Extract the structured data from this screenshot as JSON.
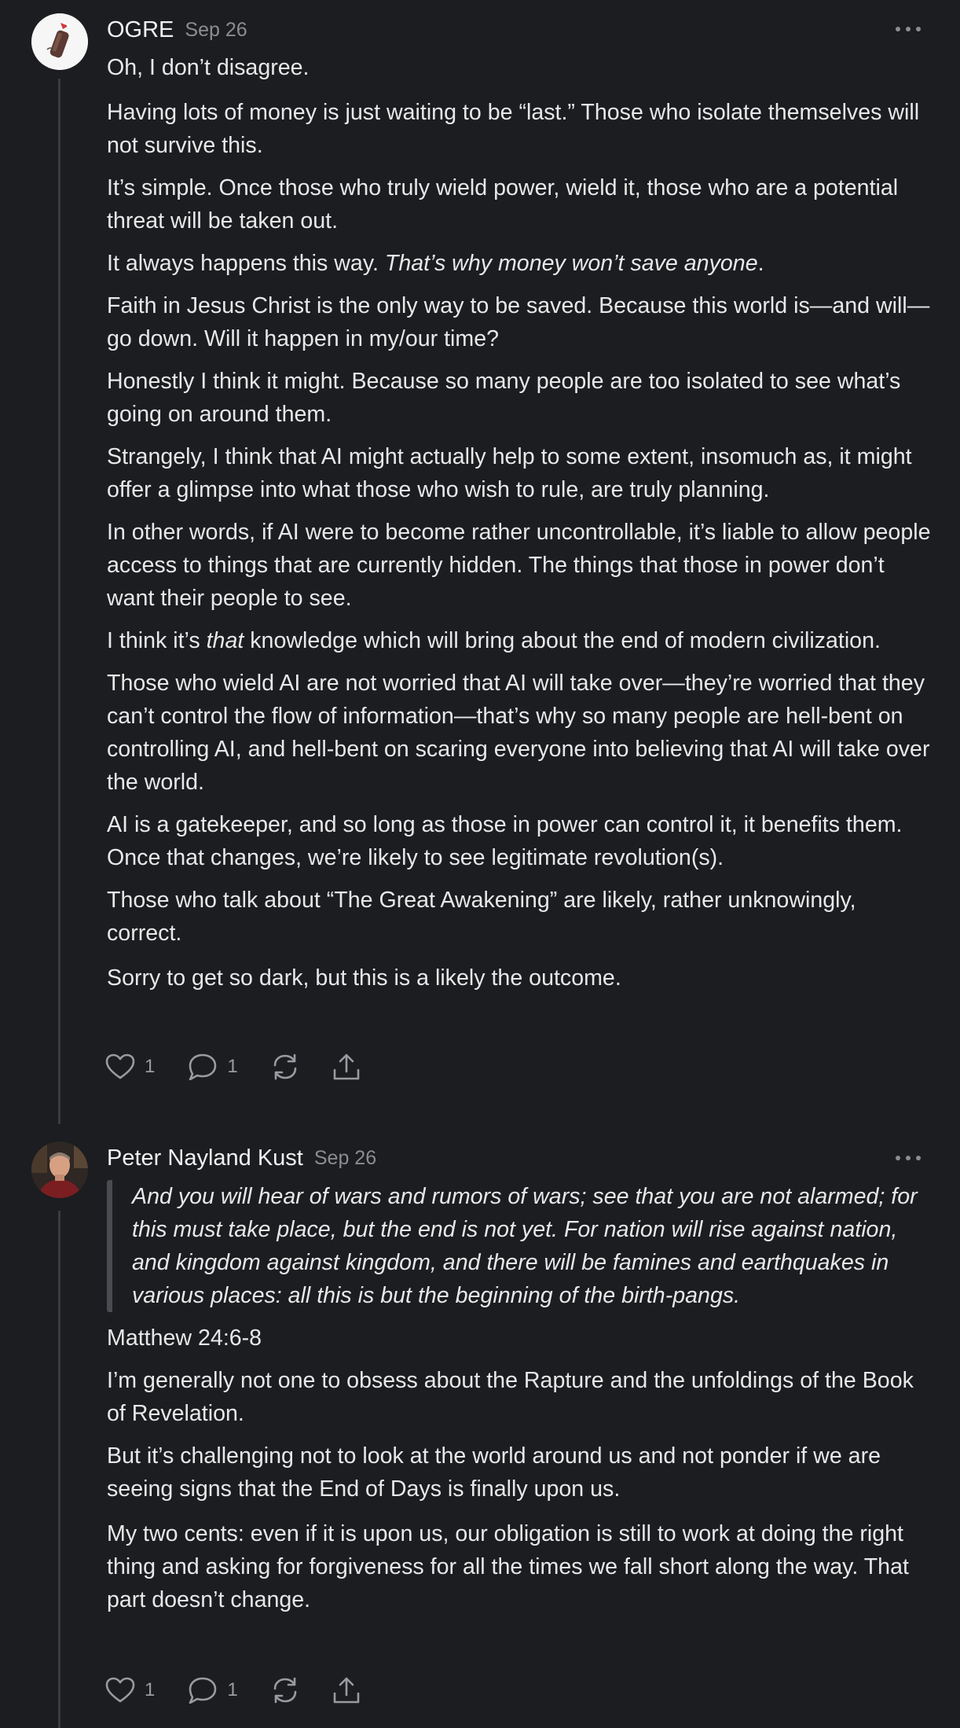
{
  "comments": [
    {
      "author": "OGRE",
      "date": "Sep 26",
      "paragraphs": [
        {
          "pre": "Oh, I don’t disagree.",
          "em": "",
          "post": ""
        },
        {
          "pre": "Having lots of money is just waiting to be “last.” Those who isolate themselves will not survive this.",
          "em": "",
          "post": ""
        },
        {
          "pre": "It’s simple. Once those who truly wield power, wield it, those who are a potential threat will be taken out.",
          "em": "",
          "post": ""
        },
        {
          "pre": "It always happens this way. ",
          "em": "That’s why money won’t save anyone",
          "post": "."
        },
        {
          "pre": "Faith in Jesus Christ is the only way to be saved. Because this world is—and will—go down. Will it happen in my/our time?",
          "em": "",
          "post": ""
        },
        {
          "pre": "Honestly I think it might. Because so many people are too isolated to see what’s going on around them.",
          "em": "",
          "post": ""
        },
        {
          "pre": "Strangely, I think that AI might actually help to some extent, insomuch as, it might offer a glimpse into what those who wish to rule, are truly planning.",
          "em": "",
          "post": ""
        },
        {
          "pre": "In other words, if AI were to become rather uncontrollable, it’s liable to allow people access to things that are currently hidden. The things that those in power don’t want their people to see.",
          "em": "",
          "post": ""
        },
        {
          "pre": "I think it’s ",
          "em": "that",
          "post": " knowledge which will bring about the end of modern civilization."
        },
        {
          "pre": "Those who wield AI are not worried that AI will take over—they’re worried that they can’t control the flow of information—that’s why so many people are hell-bent on controlling AI, and hell-bent on scaring everyone into believing that AI will take over the world.",
          "em": "",
          "post": ""
        },
        {
          "pre": "AI is a gatekeeper, and so long as those in power can control it, it benefits them. Once that changes, we’re likely to see legitimate revolution(s).",
          "em": "",
          "post": ""
        },
        {
          "pre": "Those who talk about “The Great Awakening” are likely, rather unknowingly, correct.",
          "em": "",
          "post": ""
        },
        {
          "pre": "Sorry to get so dark, but this is a likely the outcome.",
          "em": "",
          "post": ""
        }
      ],
      "likes": "1",
      "replies": "1"
    },
    {
      "author": "Peter Nayland Kust",
      "date": "Sep 26",
      "quote": "And you will hear of wars and rumors of wars; see that you are not alarmed; for this must take place, but the end is not yet. For nation will rise against nation, and kingdom against kingdom, and there will be famines and earthquakes in various places: all this is but the beginning of the birth-pangs.",
      "paragraphs": [
        {
          "pre": "Matthew 24:6-8",
          "em": "",
          "post": ""
        },
        {
          "pre": "I’m generally not one to obsess about the Rapture and the unfoldings of the Book of Revelation.",
          "em": "",
          "post": ""
        },
        {
          "pre": "But it’s challenging not to look at the world around us and not ponder if we are seeing signs that the End of Days is finally upon us.",
          "em": "",
          "post": ""
        },
        {
          "pre": "My two cents: even if it is upon us, our obligation is still to work at doing the right thing and asking for forgiveness for all the times we fall short along the way. That part doesn’t change.",
          "em": "",
          "post": ""
        }
      ],
      "likes": "1",
      "replies": "1"
    }
  ],
  "icons": {
    "like": "heart-icon",
    "reply": "comment-bubble-icon",
    "restack": "restack-icon",
    "share": "share-icon",
    "more": "more-options-icon"
  }
}
